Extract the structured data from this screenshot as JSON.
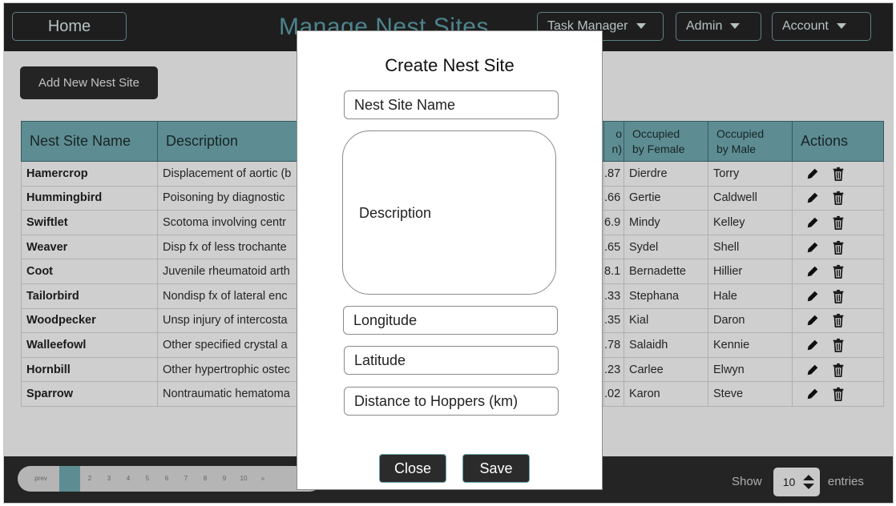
{
  "header": {
    "home_label": "Home",
    "title": "Manage Nest Sites",
    "menus": [
      "Task Manager",
      "Admin",
      "Account"
    ]
  },
  "toolbar": {
    "add_label": "Add New Nest Site"
  },
  "table": {
    "columns": [
      "Nest Site Name",
      "Description",
      "Distance to Hoppers (km)",
      "Occupied by Female",
      "Occupied by Male",
      "Actions"
    ],
    "column_headers_visible": {
      "name": "Nest Site Name",
      "description": "Description",
      "distance_fragment": [
        "o",
        "n)"
      ],
      "female_line1": "Occupied",
      "female_line2": "by Female",
      "male_line1": "Occupied",
      "male_line2": "by Male",
      "actions": "Actions"
    },
    "rows": [
      {
        "name": "Hamercrop",
        "description": "Displacement of aortic (b",
        "distance": ".87",
        "female": "Dierdre",
        "male": "Torry"
      },
      {
        "name": "Hummingbird",
        "description": "Poisoning by diagnostic",
        "distance": ".66",
        "female": "Gertie",
        "male": "Caldwell"
      },
      {
        "name": "Swiftlet",
        "description": "Scotoma involving centr",
        "distance": "6.9",
        "female": "Mindy",
        "male": "Kelley"
      },
      {
        "name": "Weaver",
        "description": "Disp fx of less trochante",
        "distance": ".65",
        "female": "Sydel",
        "male": "Shell"
      },
      {
        "name": "Coot",
        "description": "Juvenile rheumatoid arth",
        "distance": "8.1",
        "female": "Bernadette",
        "male": "Hillier"
      },
      {
        "name": "Tailorbird",
        "description": "Nondisp fx of lateral enc",
        "distance": ".33",
        "female": "Stephana",
        "male": "Hale"
      },
      {
        "name": "Woodpecker",
        "description": "Unsp injury of intercosta",
        "distance": ".35",
        "female": "Kial",
        "male": "Daron"
      },
      {
        "name": "Walleefowl",
        "description": "Other specified crystal a",
        "distance": ".78",
        "female": "Salaidh",
        "male": "Kennie"
      },
      {
        "name": "Hornbill",
        "description": "Other hypertrophic ostec",
        "distance": ".23",
        "female": "Carlee",
        "male": "Elwyn"
      },
      {
        "name": "Sparrow",
        "description": "Nontraumatic hematoma",
        "distance": ".02",
        "female": "Karon",
        "male": "Steve"
      }
    ]
  },
  "pagination": {
    "prev_label": "prev",
    "pages": [
      "1",
      "2",
      "3",
      "4",
      "5",
      "6",
      "7",
      "8",
      "9",
      "10",
      "»"
    ],
    "active_page": "1"
  },
  "page_size": {
    "show_label": "Show",
    "value": "10",
    "entries_label": "entries"
  },
  "modal": {
    "title": "Create Nest Site",
    "name_placeholder": "Nest Site Name",
    "description_placeholder": "Description",
    "longitude_placeholder": "Longitude",
    "latitude_placeholder": "Latitude",
    "distance_placeholder": "Distance to Hoppers (km)",
    "close_label": "Close",
    "save_label": "Save"
  },
  "colors": {
    "header_bg": "#242424",
    "accent": "#6fa8ae",
    "title_color": "#5d9ea8"
  },
  "icons": [
    "pencil-icon",
    "trash-icon",
    "caret-down-icon",
    "spinner-arrows-icon"
  ]
}
